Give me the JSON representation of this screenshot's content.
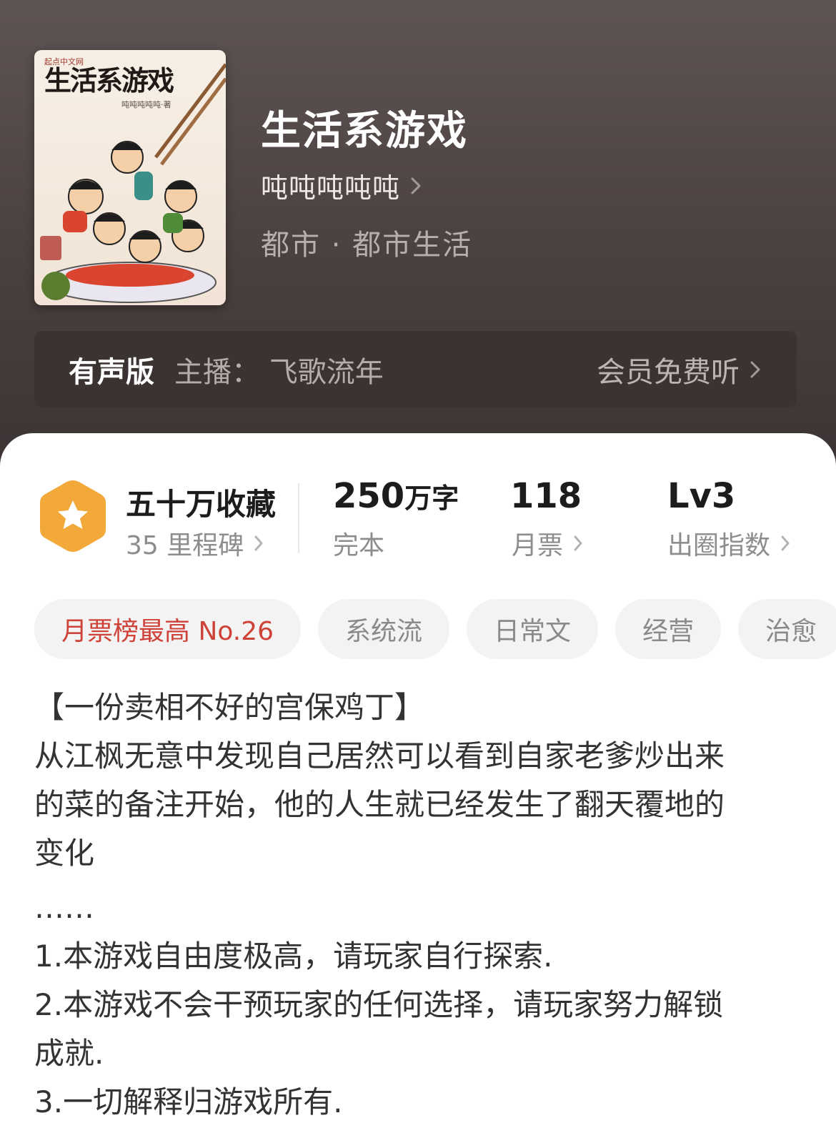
{
  "book": {
    "title": "生活系游戏",
    "author": "吨吨吨吨吨",
    "category": "都市 · 都市生活"
  },
  "cover": {
    "publisher": "起点中文网",
    "title": "生活系游戏",
    "author_line": "吨吨吨吨吨·著"
  },
  "audio": {
    "label": "有声版",
    "host": "主播：  飞歌流年",
    "cta": "会员免费听"
  },
  "stats": {
    "favorites": "五十万收藏",
    "milestones": "35 里程碑",
    "word_count_num": "250",
    "word_count_unit": "万字",
    "status": "完本",
    "monthly_votes": "118",
    "monthly_votes_label": "月票",
    "level": "Lv3",
    "level_label": "出圈指数"
  },
  "tags": [
    "月票榜最高 No.26",
    "系统流",
    "日常文",
    "经营",
    "治愈"
  ],
  "description": {
    "heading": "【一份卖相不好的宫保鸡丁】",
    "intro_lines": [
      "从江枫无意中发现自己居然可以看到自家老爹炒出来",
      "的菜的备注开始，他的人生就已经发生了翻天覆地的",
      "变化"
    ],
    "ellipsis": "……",
    "rules": [
      "1.本游戏自由度极高，请玩家自行探索.",
      "2.本游戏不会干预玩家的任何选择，请玩家努力解锁",
      "成就.",
      "3.一切解释归游戏所有."
    ]
  },
  "colors": {
    "header_bg": "#4a403f",
    "accent_red": "#cf4238",
    "badge_orange": "#f2a93a"
  },
  "icons": [
    "chevron-right-icon",
    "star-badge-icon"
  ]
}
